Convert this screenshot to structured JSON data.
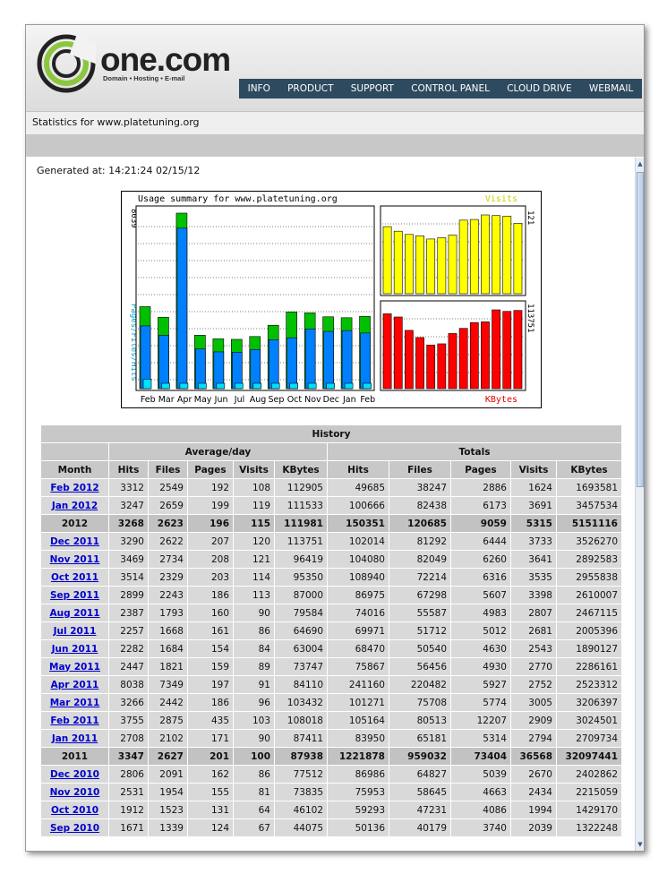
{
  "brand": {
    "name": "one.com",
    "tagline": "Domain • Hosting • E-mail",
    "accent": "#8cc63f"
  },
  "nav": [
    "INFO",
    "PRODUCT",
    "SUPPORT",
    "CONTROL PANEL",
    "CLOUD DRIVE",
    "WEBMAIL"
  ],
  "page_title": "Statistics for www.platetuning.org",
  "generated": "Generated at: 14:21:24 02/15/12",
  "chart_data": {
    "type": "bar",
    "title": "Usage summary for www.platetuning.org",
    "categories": [
      "Feb",
      "Mar",
      "Apr",
      "May",
      "Jun",
      "Jul",
      "Aug",
      "Sep",
      "Oct",
      "Nov",
      "Dec",
      "Jan",
      "Feb"
    ],
    "left_axis_label": "Pages/Files/Hits",
    "left_max_label": "8039",
    "series": [
      {
        "name": "Hits",
        "color": "#00c000",
        "values": [
          3755,
          3266,
          8038,
          2447,
          2282,
          2257,
          2387,
          2899,
          3514,
          3469,
          3290,
          3247,
          3312
        ]
      },
      {
        "name": "Files",
        "color": "#0080ff",
        "values": [
          2875,
          2442,
          7349,
          1821,
          1684,
          1668,
          1793,
          2243,
          2329,
          2734,
          2622,
          2659,
          2549
        ]
      },
      {
        "name": "Pages",
        "color": "#00e0ff",
        "values": [
          435,
          186,
          197,
          159,
          154,
          161,
          160,
          186,
          203,
          208,
          207,
          199,
          192
        ]
      }
    ],
    "visits": {
      "label": "Visits",
      "max_label": "121",
      "color": "#ffff00",
      "values": [
        103,
        96,
        91,
        89,
        84,
        86,
        90,
        113,
        114,
        121,
        120,
        119,
        108
      ]
    },
    "kbytes": {
      "label": "KBytes",
      "max_label": "113751",
      "color": "#ff0000",
      "values": [
        108018,
        103432,
        84110,
        73747,
        63004,
        64690,
        79584,
        87000,
        95350,
        96419,
        113751,
        111533,
        112905
      ]
    }
  },
  "history": {
    "title": "History",
    "group_avg": "Average/day",
    "group_totals": "Totals",
    "columns": [
      "Month",
      "Hits",
      "Files",
      "Pages",
      "Visits",
      "KBytes",
      "Hits",
      "Files",
      "Pages",
      "Visits",
      "KBytes"
    ],
    "rows": [
      {
        "month": "Feb 2012",
        "total": false,
        "v": [
          "3312",
          "2549",
          "192",
          "108",
          "112905",
          "49685",
          "38247",
          "2886",
          "1624",
          "1693581"
        ]
      },
      {
        "month": "Jan 2012",
        "total": false,
        "v": [
          "3247",
          "2659",
          "199",
          "119",
          "111533",
          "100666",
          "82438",
          "6173",
          "3691",
          "3457534"
        ]
      },
      {
        "month": "2012",
        "total": true,
        "v": [
          "3268",
          "2623",
          "196",
          "115",
          "111981",
          "150351",
          "120685",
          "9059",
          "5315",
          "5151116"
        ]
      },
      {
        "month": "Dec 2011",
        "total": false,
        "v": [
          "3290",
          "2622",
          "207",
          "120",
          "113751",
          "102014",
          "81292",
          "6444",
          "3733",
          "3526270"
        ]
      },
      {
        "month": "Nov 2011",
        "total": false,
        "v": [
          "3469",
          "2734",
          "208",
          "121",
          "96419",
          "104080",
          "82049",
          "6260",
          "3641",
          "2892583"
        ]
      },
      {
        "month": "Oct 2011",
        "total": false,
        "v": [
          "3514",
          "2329",
          "203",
          "114",
          "95350",
          "108940",
          "72214",
          "6316",
          "3535",
          "2955838"
        ]
      },
      {
        "month": "Sep 2011",
        "total": false,
        "v": [
          "2899",
          "2243",
          "186",
          "113",
          "87000",
          "86975",
          "67298",
          "5607",
          "3398",
          "2610007"
        ]
      },
      {
        "month": "Aug 2011",
        "total": false,
        "v": [
          "2387",
          "1793",
          "160",
          "90",
          "79584",
          "74016",
          "55587",
          "4983",
          "2807",
          "2467115"
        ]
      },
      {
        "month": "Jul 2011",
        "total": false,
        "v": [
          "2257",
          "1668",
          "161",
          "86",
          "64690",
          "69971",
          "51712",
          "5012",
          "2681",
          "2005396"
        ]
      },
      {
        "month": "Jun 2011",
        "total": false,
        "v": [
          "2282",
          "1684",
          "154",
          "84",
          "63004",
          "68470",
          "50540",
          "4630",
          "2543",
          "1890127"
        ]
      },
      {
        "month": "May 2011",
        "total": false,
        "v": [
          "2447",
          "1821",
          "159",
          "89",
          "73747",
          "75867",
          "56456",
          "4930",
          "2770",
          "2286161"
        ]
      },
      {
        "month": "Apr 2011",
        "total": false,
        "v": [
          "8038",
          "7349",
          "197",
          "91",
          "84110",
          "241160",
          "220482",
          "5927",
          "2752",
          "2523312"
        ]
      },
      {
        "month": "Mar 2011",
        "total": false,
        "v": [
          "3266",
          "2442",
          "186",
          "96",
          "103432",
          "101271",
          "75708",
          "5774",
          "3005",
          "3206397"
        ]
      },
      {
        "month": "Feb 2011",
        "total": false,
        "v": [
          "3755",
          "2875",
          "435",
          "103",
          "108018",
          "105164",
          "80513",
          "12207",
          "2909",
          "3024501"
        ]
      },
      {
        "month": "Jan 2011",
        "total": false,
        "v": [
          "2708",
          "2102",
          "171",
          "90",
          "87411",
          "83950",
          "65181",
          "5314",
          "2794",
          "2709734"
        ]
      },
      {
        "month": "2011",
        "total": true,
        "v": [
          "3347",
          "2627",
          "201",
          "100",
          "87938",
          "1221878",
          "959032",
          "73404",
          "36568",
          "32097441"
        ]
      },
      {
        "month": "Dec 2010",
        "total": false,
        "v": [
          "2806",
          "2091",
          "162",
          "86",
          "77512",
          "86986",
          "64827",
          "5039",
          "2670",
          "2402862"
        ]
      },
      {
        "month": "Nov 2010",
        "total": false,
        "v": [
          "2531",
          "1954",
          "155",
          "81",
          "73835",
          "75953",
          "58645",
          "4663",
          "2434",
          "2215059"
        ]
      },
      {
        "month": "Oct 2010",
        "total": false,
        "v": [
          "1912",
          "1523",
          "131",
          "64",
          "46102",
          "59293",
          "47231",
          "4086",
          "1994",
          "1429170"
        ]
      },
      {
        "month": "Sep 2010",
        "total": false,
        "v": [
          "1671",
          "1339",
          "124",
          "67",
          "44075",
          "50136",
          "40179",
          "3740",
          "2039",
          "1322248"
        ]
      }
    ]
  }
}
